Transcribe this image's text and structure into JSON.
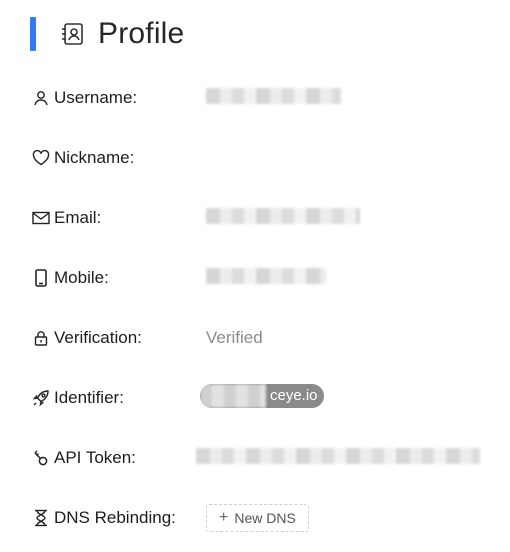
{
  "header": {
    "title": "Profile",
    "icon": "contact-card-icon",
    "accent_color": "#2f7cf6"
  },
  "fields": {
    "username": {
      "label": "Username:",
      "icon": "user-icon"
    },
    "nickname": {
      "label": "Nickname:",
      "icon": "heart-icon"
    },
    "email": {
      "label": "Email:",
      "icon": "mail-icon"
    },
    "mobile": {
      "label": "Mobile:",
      "icon": "phone-icon"
    },
    "verification": {
      "label": "Verification:",
      "icon": "lock-icon",
      "value": "Verified"
    },
    "identifier": {
      "label": "Identifier:",
      "icon": "rocket-icon",
      "value_suffix": "ceye.io"
    },
    "api_token": {
      "label": "API Token:",
      "icon": "key-icon"
    },
    "dns_rebinding": {
      "label": "DNS Rebinding:",
      "icon": "hourglass-icon",
      "button_label": "New DNS"
    }
  }
}
